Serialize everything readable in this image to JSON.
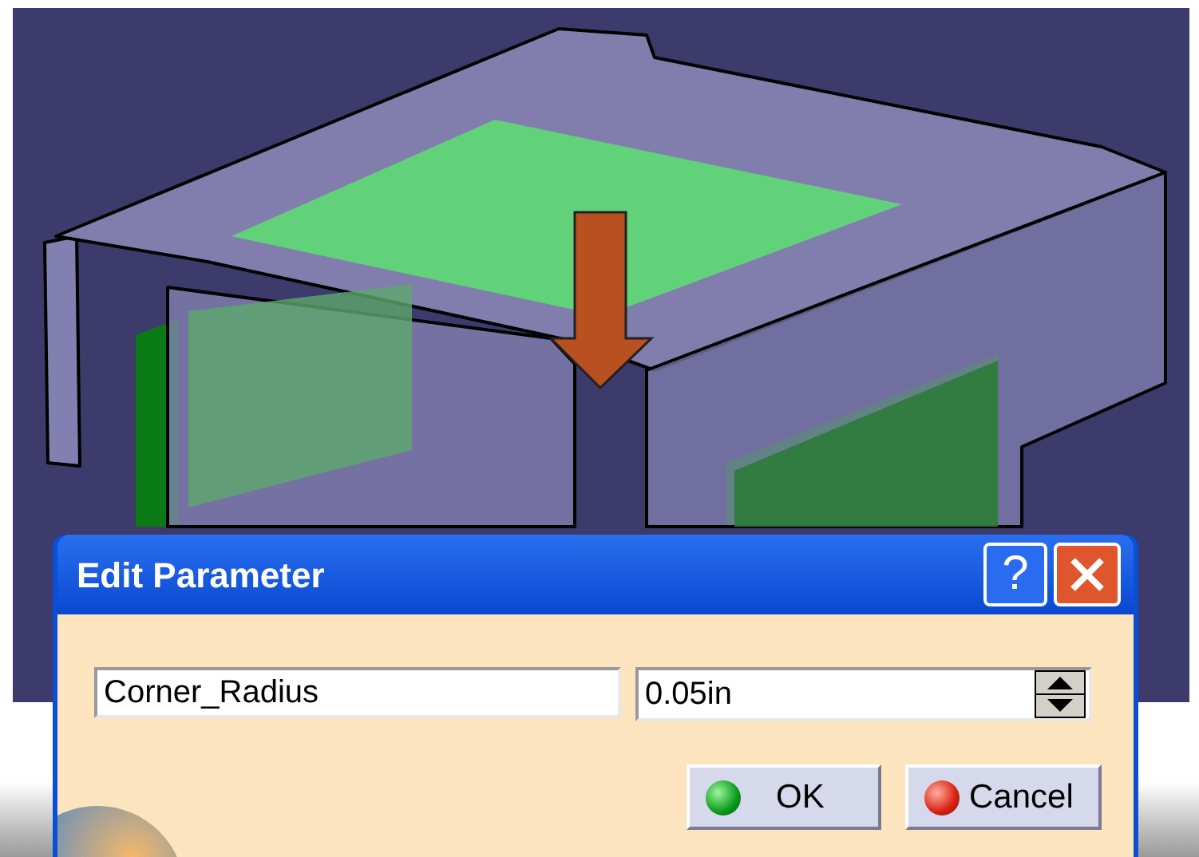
{
  "dialog": {
    "title": "Edit Parameter",
    "title_buttons": [
      {
        "label": "?",
        "kind": "help"
      },
      {
        "kind": "close"
      }
    ],
    "name_field": {
      "value": "Corner_Radius"
    },
    "value_field": {
      "value": "0.05in"
    },
    "buttons": [
      {
        "label": "OK",
        "kind": "ok"
      },
      {
        "label": "Cancel",
        "kind": "cancel"
      }
    ]
  }
}
